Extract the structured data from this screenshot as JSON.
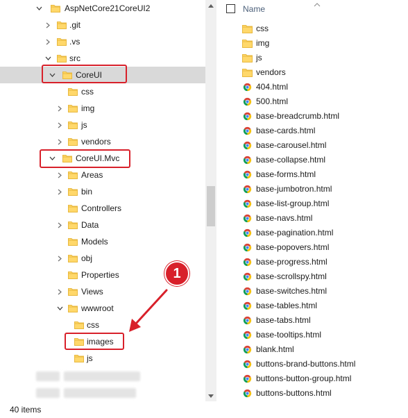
{
  "tree": {
    "items": [
      {
        "label": "AspNetCore21CoreUI2",
        "chevron": "down",
        "icon": "folder-icon"
      },
      {
        "label": ".git",
        "chevron": "right",
        "icon": "folder-icon"
      },
      {
        "label": ".vs",
        "chevron": "right",
        "icon": "folder-icon"
      },
      {
        "label": "src",
        "chevron": "down",
        "icon": "folder-icon"
      },
      {
        "label": "CoreUI",
        "chevron": "down",
        "icon": "folder-icon",
        "selected": true
      },
      {
        "label": "css",
        "chevron": "none",
        "icon": "folder-icon"
      },
      {
        "label": "img",
        "chevron": "right",
        "icon": "folder-icon"
      },
      {
        "label": "js",
        "chevron": "right",
        "icon": "folder-icon"
      },
      {
        "label": "vendors",
        "chevron": "right",
        "icon": "folder-icon"
      },
      {
        "label": "CoreUI.Mvc",
        "chevron": "down",
        "icon": "folder-icon"
      },
      {
        "label": "Areas",
        "chevron": "right",
        "icon": "folder-icon"
      },
      {
        "label": "bin",
        "chevron": "right",
        "icon": "folder-icon"
      },
      {
        "label": "Controllers",
        "chevron": "none",
        "icon": "folder-icon"
      },
      {
        "label": "Data",
        "chevron": "right",
        "icon": "folder-icon"
      },
      {
        "label": "Models",
        "chevron": "none",
        "icon": "folder-icon"
      },
      {
        "label": "obj",
        "chevron": "right",
        "icon": "folder-icon"
      },
      {
        "label": "Properties",
        "chevron": "none",
        "icon": "folder-icon"
      },
      {
        "label": "Views",
        "chevron": "right",
        "icon": "folder-icon"
      },
      {
        "label": "wwwroot",
        "chevron": "down",
        "icon": "folder-icon"
      },
      {
        "label": "css",
        "chevron": "none",
        "icon": "folder-icon"
      },
      {
        "label": "images",
        "chevron": "none",
        "icon": "folder-icon"
      },
      {
        "label": "js",
        "chevron": "none",
        "icon": "folder-icon"
      }
    ]
  },
  "annotation": {
    "step_number": "1",
    "color": "#d8202a"
  },
  "file_list": {
    "header": {
      "name_label": "Name"
    },
    "items": [
      {
        "label": "css",
        "type": "folder"
      },
      {
        "label": "img",
        "type": "folder"
      },
      {
        "label": "js",
        "type": "folder"
      },
      {
        "label": "vendors",
        "type": "folder"
      },
      {
        "label": "404.html",
        "type": "html"
      },
      {
        "label": "500.html",
        "type": "html"
      },
      {
        "label": "base-breadcrumb.html",
        "type": "html"
      },
      {
        "label": "base-cards.html",
        "type": "html"
      },
      {
        "label": "base-carousel.html",
        "type": "html"
      },
      {
        "label": "base-collapse.html",
        "type": "html"
      },
      {
        "label": "base-forms.html",
        "type": "html"
      },
      {
        "label": "base-jumbotron.html",
        "type": "html"
      },
      {
        "label": "base-list-group.html",
        "type": "html"
      },
      {
        "label": "base-navs.html",
        "type": "html"
      },
      {
        "label": "base-pagination.html",
        "type": "html"
      },
      {
        "label": "base-popovers.html",
        "type": "html"
      },
      {
        "label": "base-progress.html",
        "type": "html"
      },
      {
        "label": "base-scrollspy.html",
        "type": "html"
      },
      {
        "label": "base-switches.html",
        "type": "html"
      },
      {
        "label": "base-tables.html",
        "type": "html"
      },
      {
        "label": "base-tabs.html",
        "type": "html"
      },
      {
        "label": "base-tooltips.html",
        "type": "html"
      },
      {
        "label": "blank.html",
        "type": "html"
      },
      {
        "label": "buttons-brand-buttons.html",
        "type": "html"
      },
      {
        "label": "buttons-button-group.html",
        "type": "html"
      },
      {
        "label": "buttons-buttons.html",
        "type": "html"
      }
    ]
  },
  "status_bar": {
    "item_count": "40 items"
  },
  "colors": {
    "folder": "#ffd86b",
    "folder_dark": "#e8b83e",
    "selection": "#d9d9d9",
    "highlight": "#d8202a"
  }
}
